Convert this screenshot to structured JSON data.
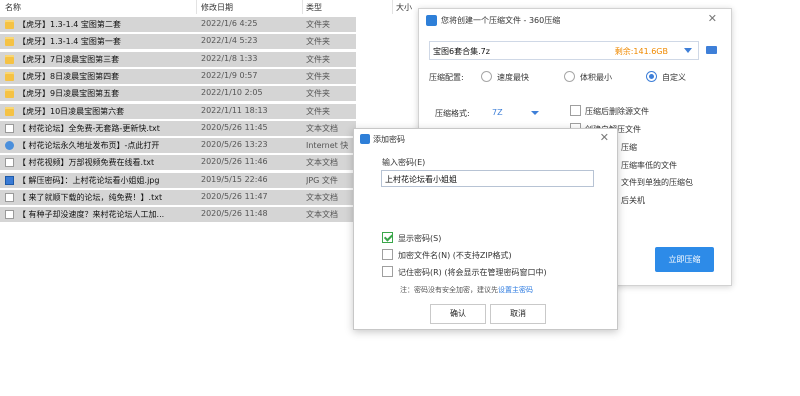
{
  "explorer": {
    "columns": {
      "name": "名称",
      "date": "修改日期",
      "type": "类型",
      "size": "大小"
    },
    "rows": [
      {
        "icon": "folder",
        "name": "【虎牙】1.3-1.4  宝图第二套",
        "date": "2022/1/6 4:25",
        "type": "文件夹",
        "selected": true
      },
      {
        "icon": "folder",
        "name": "【虎牙】1.3-1.4  宝图第一套",
        "date": "2022/1/4 5:23",
        "type": "文件夹",
        "selected": true
      },
      {
        "icon": "folder",
        "name": "【虎牙】7日凌晨宝图第三套",
        "date": "2022/1/8 1:33",
        "type": "文件夹",
        "selected": true
      },
      {
        "icon": "folder",
        "name": "【虎牙】8日凌晨宝图第四套",
        "date": "2022/1/9 0:57",
        "type": "文件夹",
        "selected": true
      },
      {
        "icon": "folder",
        "name": "【虎牙】9日凌晨宝图第五套",
        "date": "2022/1/10 2:05",
        "type": "文件夹",
        "selected": true
      },
      {
        "icon": "folder",
        "name": "【虎牙】10日凌晨宝图第六套",
        "date": "2022/1/11 18:13",
        "type": "文件夹",
        "selected": true
      },
      {
        "icon": "txt",
        "name": "【 村花论坛】全免费-无套路-更新快.txt",
        "date": "2020/5/26 11:45",
        "type": "文本文档",
        "selected": true
      },
      {
        "icon": "url",
        "name": "【 村花论坛永久地址发布页】-点此打开",
        "date": "2020/5/26 13:23",
        "type": "Internet 快",
        "selected": true
      },
      {
        "icon": "txt",
        "name": "【 村花视频】万部视频免费在线看.txt",
        "date": "2020/5/26 11:46",
        "type": "文本文档",
        "selected": true
      },
      {
        "icon": "jpg",
        "name": "【 解压密码】：上村花论坛看小姐姐.jpg",
        "date": "2019/5/15 22:46",
        "type": "JPG 文件",
        "selected": true
      },
      {
        "icon": "txt",
        "name": "【 来了就顺下载的论坛，纯免费！】.txt",
        "date": "2020/5/26 11:47",
        "type": "文本文档",
        "selected": true
      },
      {
        "icon": "txt",
        "name": "【 有种子却没速度？来村花论坛人工加...",
        "date": "2020/5/26 11:48",
        "type": "文本文档",
        "selected": true
      }
    ]
  },
  "zip_dialog": {
    "title": "您将创建一个压缩文件 - 360压缩",
    "close": "✕",
    "filename": "宝图6套合集.7z",
    "free_space": "剩余:141.6GB",
    "config_label": "压缩配置:",
    "config_options": [
      "速度最快",
      "体积最小",
      "自定义"
    ],
    "config_selected": 2,
    "format_label": "压缩格式:",
    "format_value": "7Z",
    "options": [
      "压缩后删除源文件",
      "创建自解压文件",
      "压缩",
      "压缩率低的文件",
      "文件到单独的压缩包",
      "后关机"
    ],
    "submit": "立即压缩"
  },
  "password_dialog": {
    "title": "添加密码",
    "close": "✕",
    "input_label": "输入密码(E)",
    "password": "上村花论坛看小姐姐",
    "options": [
      {
        "label": "显示密码(S)",
        "checked": true
      },
      {
        "label": "加密文件名(N) (不支持ZIP格式)",
        "checked": false
      },
      {
        "label": "记住密码(R) (将会显示在管理密码窗口中)",
        "checked": false
      }
    ],
    "note": "注：密码没有安全加密，建议先",
    "note_link": "设置主密码",
    "ok": "确认",
    "cancel": "取消"
  }
}
